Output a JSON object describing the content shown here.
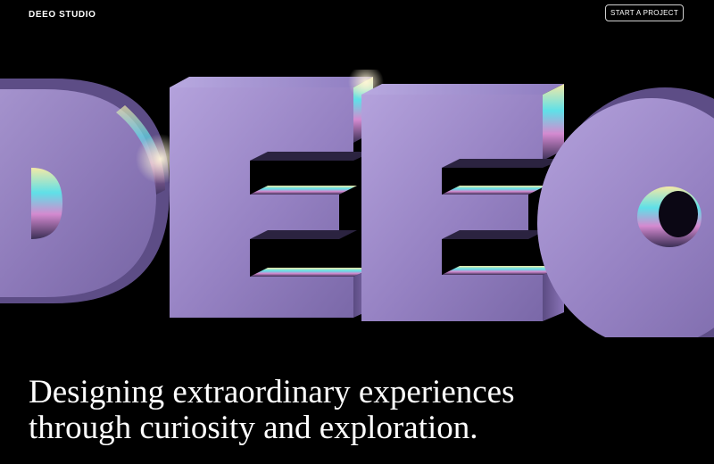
{
  "header": {
    "logo_text": "DEEO STUDIO",
    "cta_label": "START A PROJECT"
  },
  "hero": {
    "letters": [
      "D",
      "E",
      "E",
      "O"
    ],
    "tagline_line1": "Designing extraordinary experiences",
    "tagline_line2": "through curiosity and exploration."
  },
  "colors": {
    "background": "#000000",
    "text": "#ffffff",
    "letter_face": "#9a84c4",
    "letter_top": "#a38fd1",
    "letter_side": "#6e5a96",
    "iridescent_cyan": "#5fe0e8",
    "iridescent_yellow": "#f3e9a6"
  }
}
